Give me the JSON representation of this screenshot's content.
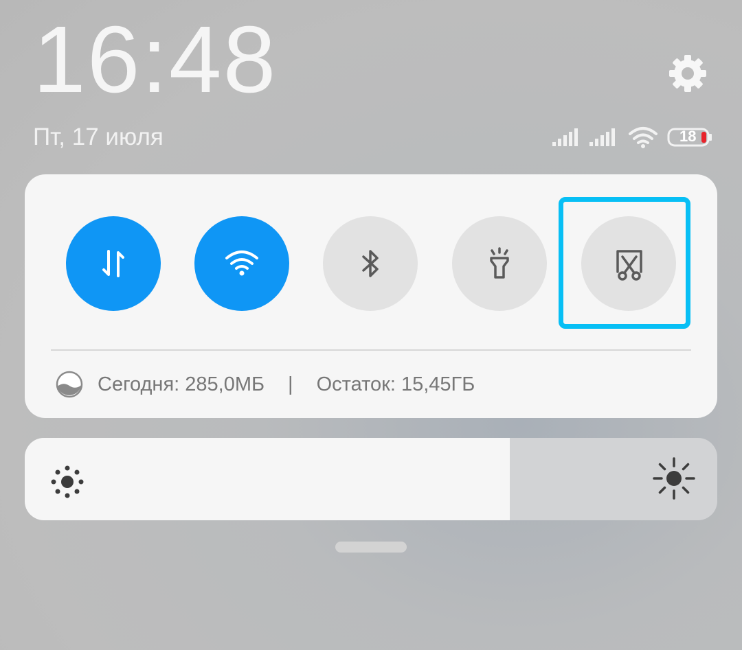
{
  "header": {
    "time": "16:48",
    "date": "Пт, 17 июля",
    "battery_level": "18"
  },
  "toggles": [
    {
      "name": "mobile-data",
      "icon": "mobile-data-icon",
      "active": true
    },
    {
      "name": "wifi",
      "icon": "wifi-icon",
      "active": true
    },
    {
      "name": "bluetooth",
      "icon": "bluetooth-icon",
      "active": false
    },
    {
      "name": "flashlight",
      "icon": "flashlight-icon",
      "active": false
    },
    {
      "name": "screenshot",
      "icon": "screenshot-icon",
      "active": false,
      "highlighted": true
    }
  ],
  "data_usage": {
    "today": "Сегодня: 285,0МБ",
    "separator": "|",
    "remaining": "Остаток: 15,45ГБ"
  },
  "brightness": {
    "level": 0.7
  },
  "colors": {
    "accent": "#0f96f5",
    "highlight": "#07bff5",
    "battery_low": "#e8232b"
  }
}
